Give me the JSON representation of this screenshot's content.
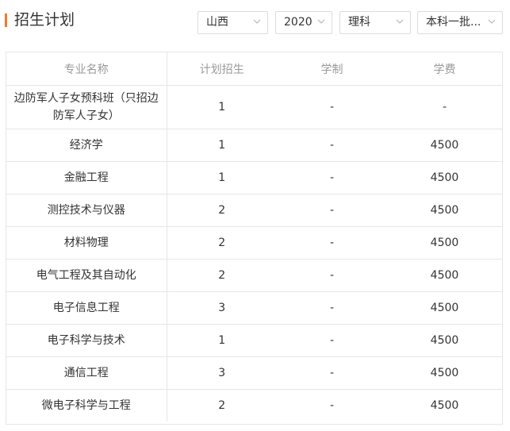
{
  "header": {
    "title": "招生计划"
  },
  "filters": {
    "province": "山西",
    "year": "2020",
    "subject": "理科",
    "batch": "本科一批..."
  },
  "table": {
    "columns": [
      "专业名称",
      "计划招生",
      "学制",
      "学费"
    ],
    "rows": [
      {
        "major": "边防军人子女预科班（只招边防军人子女）",
        "plan": "1",
        "duration": "-",
        "fee": "-"
      },
      {
        "major": "经济学",
        "plan": "1",
        "duration": "-",
        "fee": "4500"
      },
      {
        "major": "金融工程",
        "plan": "1",
        "duration": "-",
        "fee": "4500"
      },
      {
        "major": "测控技术与仪器",
        "plan": "2",
        "duration": "-",
        "fee": "4500"
      },
      {
        "major": "材料物理",
        "plan": "2",
        "duration": "-",
        "fee": "4500"
      },
      {
        "major": "电气工程及其自动化",
        "plan": "2",
        "duration": "-",
        "fee": "4500"
      },
      {
        "major": "电子信息工程",
        "plan": "3",
        "duration": "-",
        "fee": "4500"
      },
      {
        "major": "电子科学与技术",
        "plan": "1",
        "duration": "-",
        "fee": "4500"
      },
      {
        "major": "通信工程",
        "plan": "3",
        "duration": "-",
        "fee": "4500"
      },
      {
        "major": "微电子科学与工程",
        "plan": "2",
        "duration": "-",
        "fee": "4500"
      }
    ]
  },
  "colors": {
    "accent": "#f07a2c",
    "border": "#e6e6e6",
    "header_text": "#999999",
    "body_text": "#333333"
  },
  "icons": {
    "select_arrow": "chevron-down-icon"
  }
}
